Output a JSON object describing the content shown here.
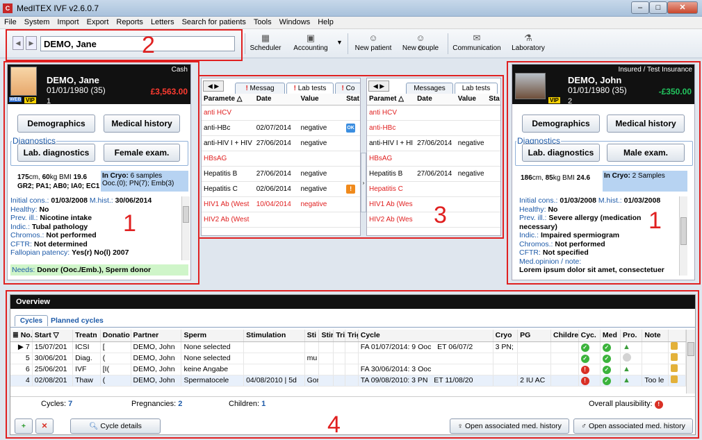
{
  "window": {
    "title": "MedITEX IVF v2.6.0.7",
    "logo": "C"
  },
  "menu": [
    "File",
    "System",
    "Import",
    "Export",
    "Reports",
    "Letters",
    "Search for patients",
    "Tools",
    "Windows",
    "Help"
  ],
  "toolbar": {
    "patient_name": "DEMO, Jane",
    "buttons": [
      {
        "label": "Scheduler",
        "icon": "calendar-icon"
      },
      {
        "label": "Accounting",
        "icon": "accounting-icon"
      },
      {
        "label": "New patient",
        "icon": "new-patient-icon"
      },
      {
        "label": "New couple",
        "icon": "new-couple-icon"
      },
      {
        "label": "Communication",
        "icon": "communication-icon"
      },
      {
        "label": "Laboratory",
        "icon": "laboratory-icon"
      }
    ]
  },
  "annotations": {
    "n1": "1",
    "n2": "2",
    "n3": "3",
    "n4": "4"
  },
  "female": {
    "payment": "Cash",
    "name": "DEMO, Jane",
    "dob": "01/01/1980",
    "age": "(35)",
    "balance": "£3,563.00",
    "badge_web": "WEB",
    "badge_vip": "VIP",
    "count": "1",
    "btn_demographics": "Demographics",
    "btn_medhistory": "Medical history",
    "diagnostics_label": "Diagnostics",
    "btn_lab": "Lab. diagnostics",
    "btn_exam": "Female exam.",
    "height_cm": "175",
    "height_unit": "cm,",
    "weight": "60",
    "weight_unit": "kg BMI",
    "bmi": "19.6",
    "gpa": "GR2; PA1; AB0; IA0; EC1",
    "cryo_label": "In Cryo:",
    "cryo_value": "6 samples",
    "cryo_detail": "Ooc.(0); PN(7); Emb(3)",
    "initial_label": "Initial cons.:",
    "initial_value": "01/03/2008",
    "mhist_label": "M.hist.:",
    "mhist_value": "30/06/2014",
    "healthy_label": "Healthy:",
    "healthy_value": "No",
    "prev_label": "Prev. ill.:",
    "prev_value": "Nicotine intake",
    "indic_label": "Indic.:",
    "indic_value": "Tubal pathology",
    "chromos_label": "Chromos.:",
    "chromos_value": "Not performed",
    "cftr_label": "CFTR:",
    "cftr_value": "Not determined",
    "fallopian_label": "Fallopian patency:",
    "fallopian_value": "Yes(r) No(l) 2007",
    "needs_label": "Needs:",
    "needs_value": "Donor (Ooc./Emb.), Sperm donor"
  },
  "male": {
    "payment": "Insured / Test Insurance",
    "name": "DEMO, John",
    "dob": "01/01/1980",
    "age": "(35)",
    "balance": "-£350.00",
    "badge_vip": "VIP",
    "count": "2",
    "btn_demographics": "Demographics",
    "btn_medhistory": "Medical history",
    "diagnostics_label": "Diagnostics",
    "btn_lab": "Lab. diagnostics",
    "btn_exam": "Male exam.",
    "height_cm": "186",
    "height_unit": "cm,",
    "weight": "85",
    "weight_unit": "kg BMI",
    "bmi": "24.6",
    "cryo_label": "In Cryo:",
    "cryo_value": "2 Samples",
    "initial_label": "Initial cons.:",
    "initial_value": "01/03/2008",
    "mhist_label": "M.hist.:",
    "mhist_value": "01/03/2008",
    "healthy_label": "Healthy:",
    "healthy_value": "No",
    "prev_label": "Prev. ill.:",
    "prev_value": "Severe allergy (medication necessary)",
    "indic_label": "Indic.:",
    "indic_value": "Impaired spermiogram",
    "chromos_label": "Chromos.:",
    "chromos_value": "Not performed",
    "cftr_label": "CFTR:",
    "cftr_value": "Not specified",
    "medop_label": "Med.opinion / note:",
    "medop_value": "Lorem ipsum dolor sit amet, consectetuer"
  },
  "lab_left": {
    "tabs": [
      "Messag",
      "Lab tests",
      "Co"
    ],
    "headers": [
      "Paramete",
      "Date",
      "Value",
      "Stat"
    ],
    "rows": [
      {
        "param": "anti HCV",
        "date": "",
        "value": "",
        "red": true,
        "status": ""
      },
      {
        "param": "anti-HBc",
        "date": "02/07/2014",
        "value": "negative",
        "red": false,
        "status": "OK"
      },
      {
        "param": "anti-HIV I + HIV",
        "date": "27/06/2014",
        "value": "negative",
        "red": false,
        "status": ""
      },
      {
        "param": "HBsAG",
        "date": "",
        "value": "",
        "red": true,
        "status": ""
      },
      {
        "param": "Hepatitis B",
        "date": "27/06/2014",
        "value": "negative",
        "red": false,
        "status": ""
      },
      {
        "param": "Hepatitis C",
        "date": "02/06/2014",
        "value": "negative",
        "red": false,
        "status": "!"
      },
      {
        "param": "HIV1 Ab (West",
        "date": "10/04/2014",
        "value": "negative",
        "red": true,
        "status": ""
      },
      {
        "param": "HIV2 Ab (West",
        "date": "",
        "value": "",
        "red": true,
        "status": ""
      }
    ]
  },
  "lab_right": {
    "tabs": [
      "Messages",
      "Lab tests"
    ],
    "headers": [
      "Paramet",
      "Date",
      "Value",
      "Sta"
    ],
    "rows": [
      {
        "param": "anti HCV",
        "date": "",
        "value": "",
        "red": true
      },
      {
        "param": "anti-HBc",
        "date": "",
        "value": "",
        "red": true
      },
      {
        "param": "anti-HIV I + HI",
        "date": "27/06/2014",
        "value": "negative",
        "red": false
      },
      {
        "param": "HBsAG",
        "date": "",
        "value": "",
        "red": true
      },
      {
        "param": "Hepatitis B",
        "date": "27/06/2014",
        "value": "negative",
        "red": false
      },
      {
        "param": "Hepatitis C",
        "date": "",
        "value": "",
        "red": true
      },
      {
        "param": "HIV1 Ab (Wes",
        "date": "",
        "value": "",
        "red": true
      },
      {
        "param": "HIV2 Ab (Wes",
        "date": "",
        "value": "",
        "red": true
      }
    ]
  },
  "overview": {
    "title": "Overview",
    "tabs": [
      "Cycles",
      "Planned cycles"
    ],
    "headers": [
      "No.",
      "Start",
      "Treatn",
      "Donatio",
      "Partner",
      "Sperm",
      "Stimulation",
      "Sti",
      "Stir",
      "Tri",
      "Trig",
      "Cycle",
      "Cryo",
      "PG",
      "Childre",
      "Cyc.",
      "Med",
      "Pro.",
      "Note"
    ],
    "rows": [
      {
        "no": "7",
        "start": "15/07/201",
        "treat": "ICSI",
        "don": "[",
        "partner": "DEMO, John",
        "sperm": "None selected",
        "stim": "",
        "sti": "",
        "stir": "",
        "cycle": "FA 01/07/2014: 9 Ooc",
        "cycle2": "ET 06/07/2",
        "cryo": "3 PN;",
        "pg": "",
        "note": "",
        "cyc": "g",
        "med": "g",
        "pro": "thumb",
        "sel": true
      },
      {
        "no": "5",
        "start": "30/06/201",
        "treat": "Diag.",
        "don": "(",
        "partner": "DEMO, John",
        "sperm": "None selected",
        "stim": "",
        "sti": "mu",
        "stir": "",
        "cycle": "",
        "cycle2": "",
        "cryo": "",
        "pg": "",
        "note": "",
        "cyc": "g",
        "med": "g",
        "pro": "gray",
        "sel": false
      },
      {
        "no": "6",
        "start": "25/06/201",
        "treat": "IVF",
        "don": "[I(",
        "partner": "DEMO, John",
        "sperm": "keine Angabe",
        "stim": "",
        "sti": "",
        "stir": "",
        "cycle": "FA 30/06/2014: 3 Ooc",
        "cycle2": "",
        "cryo": "",
        "pg": "",
        "note": "",
        "cyc": "r",
        "med": "g",
        "pro": "thumb",
        "sel": false
      },
      {
        "no": "4",
        "start": "02/08/201",
        "treat": "Thaw",
        "don": "(",
        "partner": "DEMO, John",
        "sperm": "Spermatocele",
        "stim": "04/08/2010 | 5d",
        "sti": "Gor",
        "stir": "",
        "cycle": "TA 09/08/2010: 3 PN",
        "cycle2": "ET 11/08/20",
        "cryo": "",
        "pg": "2 IU AC",
        "note": "Too le",
        "cyc": "r",
        "med": "g",
        "pro": "thumb",
        "sel": false
      }
    ],
    "footer": {
      "cycles_label": "Cycles:",
      "cycles_value": "7",
      "preg_label": "Pregnancies:",
      "preg_value": "2",
      "children_label": "Children:",
      "children_value": "1",
      "plaus_label": "Overall plausibility:"
    },
    "buttons": {
      "details": "Cycle details",
      "open_female": "Open associated med. history",
      "open_male": "Open associated med. history"
    }
  },
  "colors": {
    "accent_red": "#e02020",
    "brand_blue": "#1d5aa8",
    "balance_female": "#ff3b30",
    "balance_male": "#22c55e"
  }
}
